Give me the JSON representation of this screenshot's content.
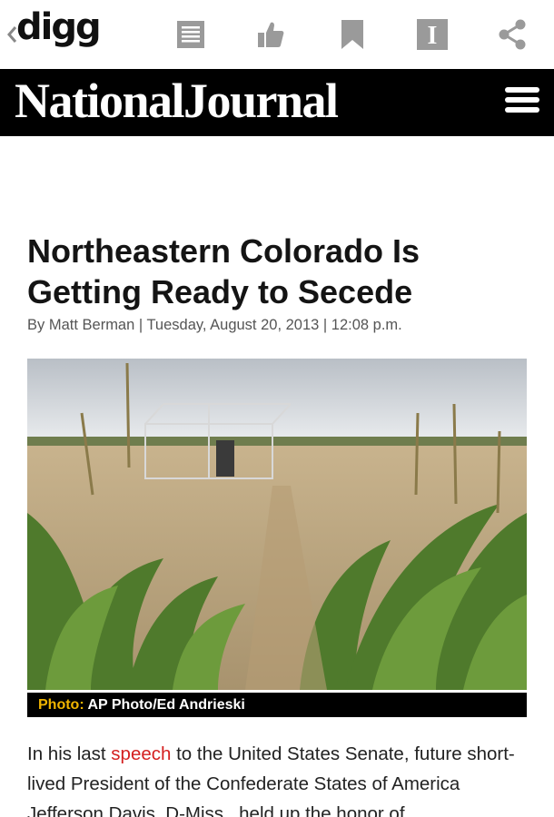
{
  "toolbar": {
    "logo": "digg",
    "icons": [
      "back-chevron-icon",
      "reader-icon",
      "thumbs-up-icon",
      "bookmark-icon",
      "instapaper-icon",
      "share-icon"
    ]
  },
  "masthead": {
    "title": "NationalJournal"
  },
  "article": {
    "headline": "Northeastern Colorado Is Getting Ready to Secede",
    "byline": "By Matt Berman | Tuesday, August 20, 2013 | 12:08 p.m.",
    "photo": {
      "caption_label": "Photo:",
      "caption_text": "AP Photo/Ed Andrieski"
    },
    "body": {
      "before_link": "In his last ",
      "link": "speech",
      "after_link": " to the United States Senate, future short-lived President of the Confederate States of America Jefferson Davis, D-Miss., held up the honor of"
    }
  },
  "colors": {
    "masthead_bg": "#000000",
    "link": "#d42020",
    "caption_label": "#f0b400",
    "toolbar_icons": "#9a9a9a"
  }
}
